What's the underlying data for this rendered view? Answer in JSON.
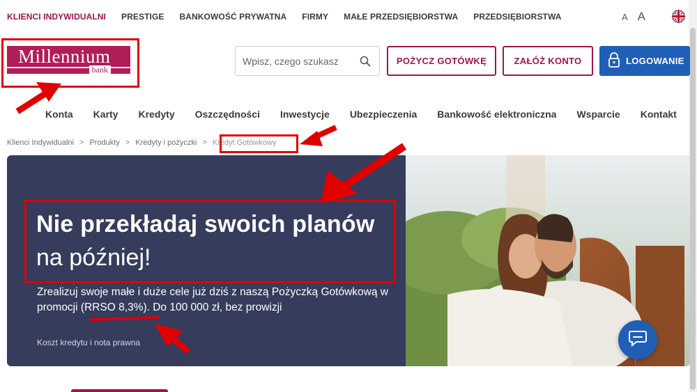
{
  "topnav": {
    "items": [
      {
        "label": "KLIENCI INDYWIDUALNI",
        "active": true
      },
      {
        "label": "PRESTIGE"
      },
      {
        "label": "BANKOWOŚĆ PRYWATNA"
      },
      {
        "label": "FIRMY"
      },
      {
        "label": "MAŁE PRZEDSIĘBIORSTWA"
      },
      {
        "label": "PRZEDSIĘBIORSTWA"
      }
    ],
    "font_small": "A",
    "font_large": "A",
    "language_icon": "uk-flag-icon"
  },
  "logo": {
    "name": "Millennium",
    "sub": "bank"
  },
  "search": {
    "placeholder": "Wpisz, czego szukasz",
    "icon": "search-icon"
  },
  "header_buttons": {
    "borrow": "POŻYCZ GOTÓWKĘ",
    "open_account": "ZAŁÓŻ KONTO",
    "login": "LOGOWANIE",
    "login_icon": "lock-icon"
  },
  "mainnav": {
    "items": [
      "Konta",
      "Karty",
      "Kredyty",
      "Oszczędności",
      "Inwestycje",
      "Ubezpieczenia",
      "Bankowość elektroniczna",
      "Wsparcie",
      "Kontakt"
    ]
  },
  "breadcrumb": {
    "items": [
      "Klienci Indywidualni",
      "Produkty",
      "Kredyty i pożyczki",
      "Kredyt Gotówkowy"
    ],
    "separator": ">"
  },
  "hero": {
    "title_bold": "Nie przekładaj swoich planów",
    "title_light": "na później!",
    "description": "Zrealizuj swoje małe i duże cele już dziś z naszą Pożyczką Gotówkową w promocji (RRSO 8,3%). Do 100 000 zł, bez prowizji",
    "cost_link": "Koszt kredytu i nota prawna"
  },
  "chat": {
    "icon": "chat-icon"
  },
  "colors": {
    "brand": "#a0154a",
    "login_blue": "#1f5fb6",
    "hero_bg": "#353c5c",
    "annotation_red": "#e00000"
  }
}
